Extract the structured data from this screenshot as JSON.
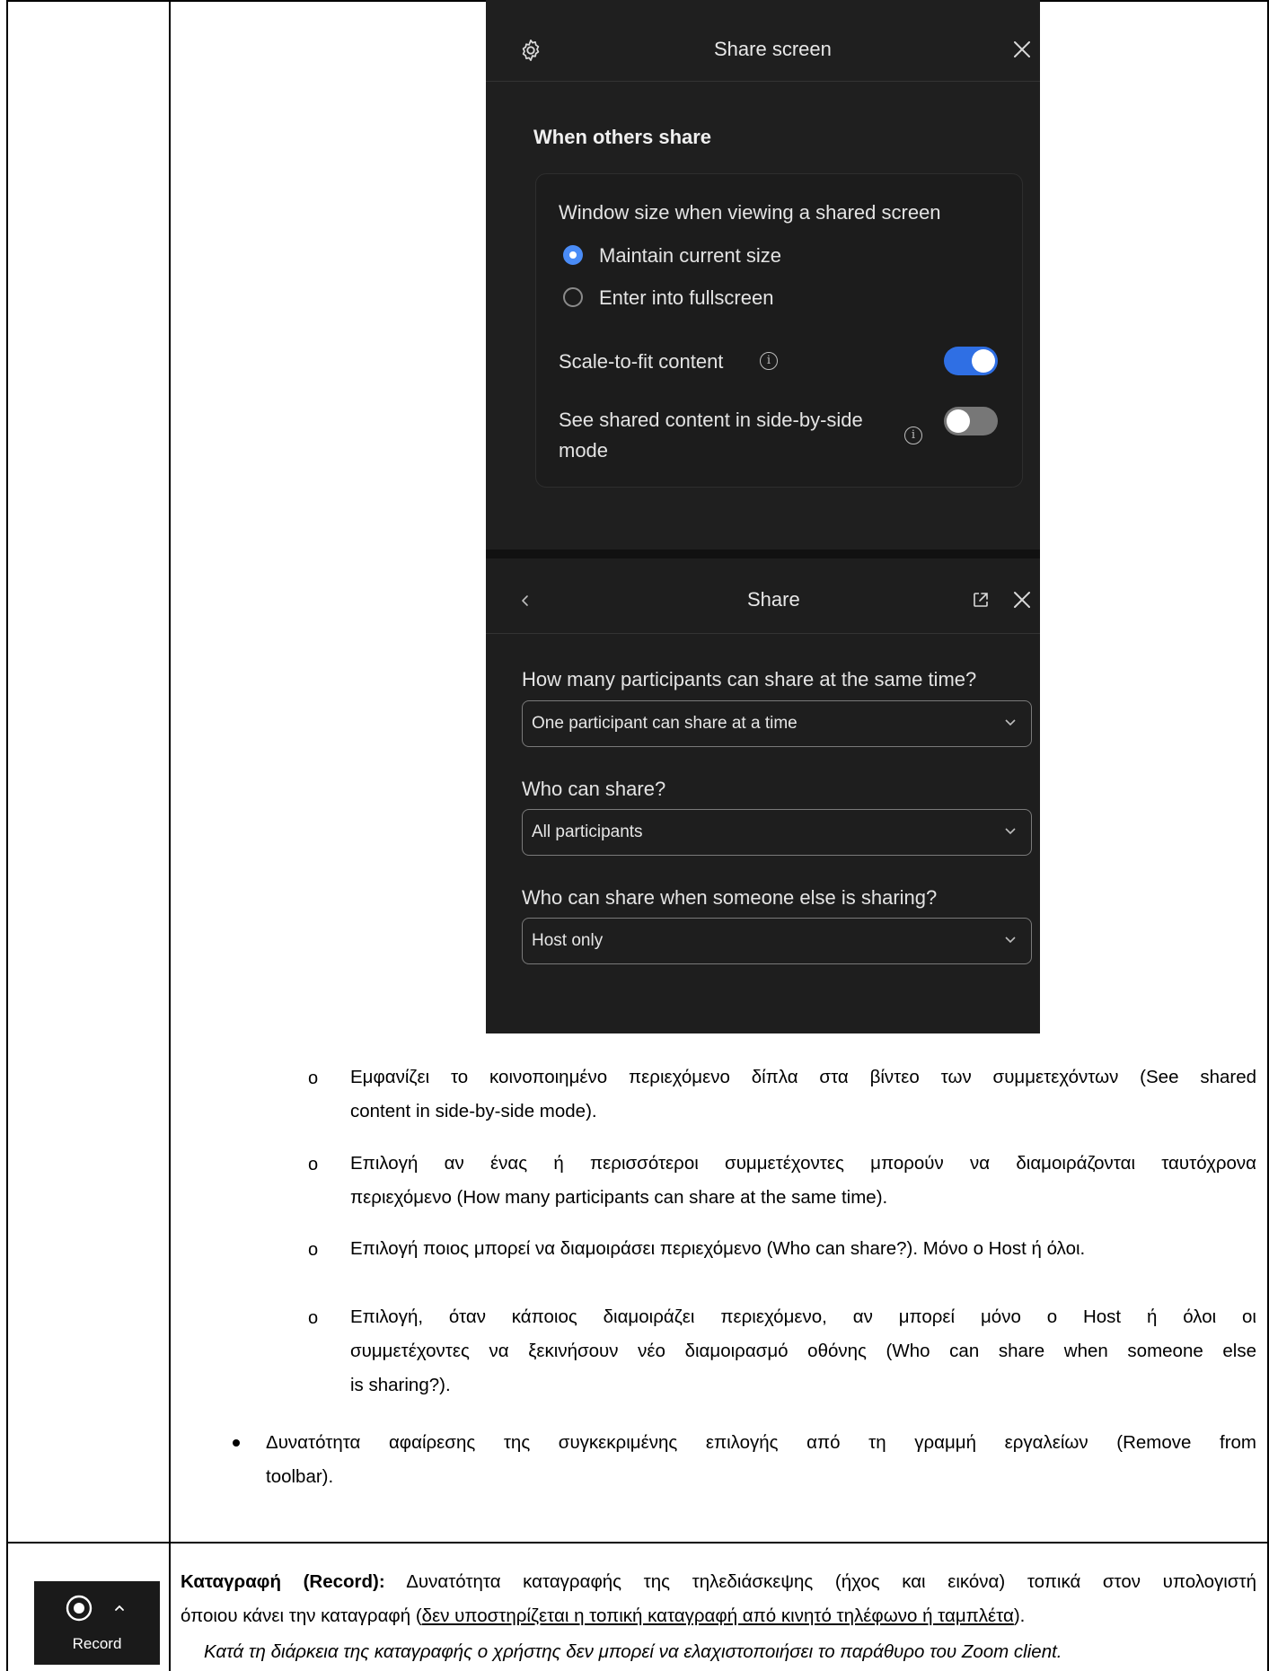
{
  "share_screen_panel": {
    "title": "Share screen",
    "section_title": "When others share",
    "window_size_label": "Window size when viewing a shared screen",
    "option_maintain": "Maintain current size",
    "option_fullscreen": "Enter into fullscreen",
    "selected_option": "Maintain current size",
    "scale_to_fit_label": "Scale-to-fit content",
    "scale_to_fit_on": true,
    "side_by_side_label_line1": "See shared content in side-by-side",
    "side_by_side_label_line2": "mode",
    "side_by_side_on": false,
    "accent_color": "#4a8cf7",
    "icons": [
      "gear-icon",
      "close-icon",
      "info-icon"
    ]
  },
  "share_panel": {
    "title": "Share",
    "q1_label": "How many participants can share at the same time?",
    "q1_value": "One participant can share at a time",
    "q2_label": "Who can share?",
    "q2_value": "All participants",
    "q3_label": "Who can share when someone else is sharing?",
    "q3_value": "Host only",
    "icons": [
      "back-chevron-icon",
      "popout-icon",
      "close-icon",
      "chevron-down-icon"
    ]
  },
  "doc": {
    "sub1_l1": "Εμφανίζει το κοινοποιημένο περιεχόμενο δίπλα στα βίντεο των συμμετεχόντων (See shared",
    "sub1_l2": "content in side-by-side mode).",
    "sub2_l1": "Επιλογή αν ένας ή περισσότεροι συμμετέχοντες μπορούν να διαμοιράζονται ταυτόχρονα",
    "sub2_l2": "περιεχόμενο (How many participants can share at the same time).",
    "sub3_l1": "Επιλογή ποιος μπορεί να διαμοιράσει περιεχόμενο (Who can share?). Μόνο ο Host ή όλοι.",
    "sub4_l1": "Επιλογή, όταν κάποιος διαμοιράζει περιεχόμενο, αν μπορεί μόνο ο Host ή όλοι οι",
    "sub4_l2": "συμμετέχοντες να ξεκινήσουν νέο διαμοιρασμό οθόνης (Who can share when someone else",
    "sub4_l3": "is sharing?).",
    "bullet_l1": "Δυνατότητα αφαίρεσης της συγκεκριμένης επιλογής από τη γραμμή εργαλείων (Remove from",
    "bullet_l2": "toolbar).",
    "record_bold": "Καταγραφή (Record):",
    "record_l1_rest": " Δυνατότητα καταγραφής της τηλεδιάσκεψης (ήχος και εικόνα) τοπικά στον υπολογιστή",
    "record_l2_pre": "όποιου κάνει την καταγραφή (",
    "record_l2_link": "δεν υποστηρίζεται η τοπική καταγραφή από κινητό τηλέφωνο ή ταμπλέτα",
    "record_l2_post": ").",
    "record_note": "Κατά τη διάρκεια της καταγραφής ο χρήστης δεν μπορεί να ελαχιστοποιήσει το παράθυρο του Zoom client."
  },
  "record_button": {
    "label": "Record",
    "icons": [
      "record-icon",
      "caret-up-icon"
    ]
  }
}
